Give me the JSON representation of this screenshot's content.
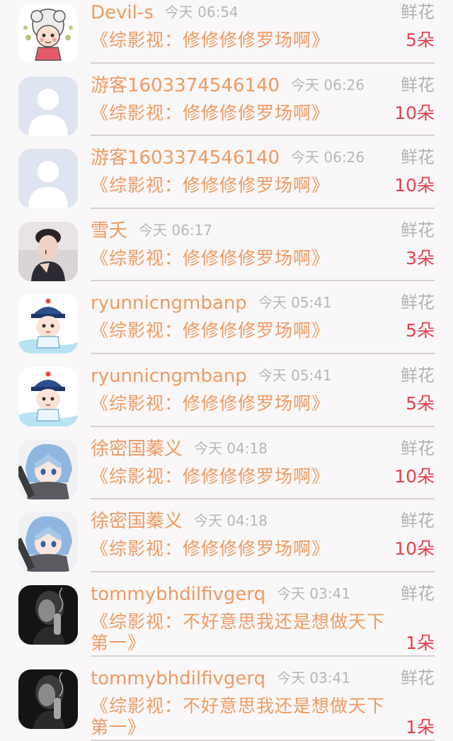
{
  "gift_list": {
    "items": [
      {
        "name": "Devil-s",
        "time": "今天 06:54",
        "gift": "鲜花",
        "book": "《综影视：修修修修罗场啊》",
        "count": "5朵",
        "avatar": "cartoon-girl"
      },
      {
        "name": "游客1603374546140",
        "time": "今天 06:26",
        "gift": "鲜花",
        "book": "《综影视：修修修修罗场啊》",
        "count": "10朵",
        "avatar": "default"
      },
      {
        "name": "游客1603374546140",
        "time": "今天 06:26",
        "gift": "鲜花",
        "book": "《综影视：修修修修罗场啊》",
        "count": "10朵",
        "avatar": "default"
      },
      {
        "name": "雪夭",
        "time": "今天 06:17",
        "gift": "鲜花",
        "book": "《综影视：修修修修罗场啊》",
        "count": "3朵",
        "avatar": "photo-man"
      },
      {
        "name": "ryunnicngmbanp",
        "time": "今天 05:41",
        "gift": "鲜花",
        "book": "《综影视：修修修修罗场啊》",
        "count": "5朵",
        "avatar": "cartoon-official"
      },
      {
        "name": "ryunnicngmbanp",
        "time": "今天 05:41",
        "gift": "鲜花",
        "book": "《综影视：修修修修罗场啊》",
        "count": "5朵",
        "avatar": "cartoon-official"
      },
      {
        "name": "徐密国蓁义",
        "time": "今天 04:18",
        "gift": "鲜花",
        "book": "《综影视：修修修修罗场啊》",
        "count": "10朵",
        "avatar": "anime-blue-hair"
      },
      {
        "name": "徐密国蓁义",
        "time": "今天 04:18",
        "gift": "鲜花",
        "book": "《综影视：修修修修罗场啊》",
        "count": "10朵",
        "avatar": "anime-blue-hair"
      },
      {
        "name": "tommybhdilfivgerq",
        "time": "今天 03:41",
        "gift": "鲜花",
        "book": "《综影视：不好意思我还是想做天下第一》",
        "count": "1朵",
        "avatar": "bw-smoking"
      },
      {
        "name": "tommybhdilfivgerq",
        "time": "今天 03:41",
        "gift": "鲜花",
        "book": "《综影视：不好意思我还是想做天下第一》",
        "count": "1朵",
        "avatar": "bw-smoking"
      }
    ]
  }
}
